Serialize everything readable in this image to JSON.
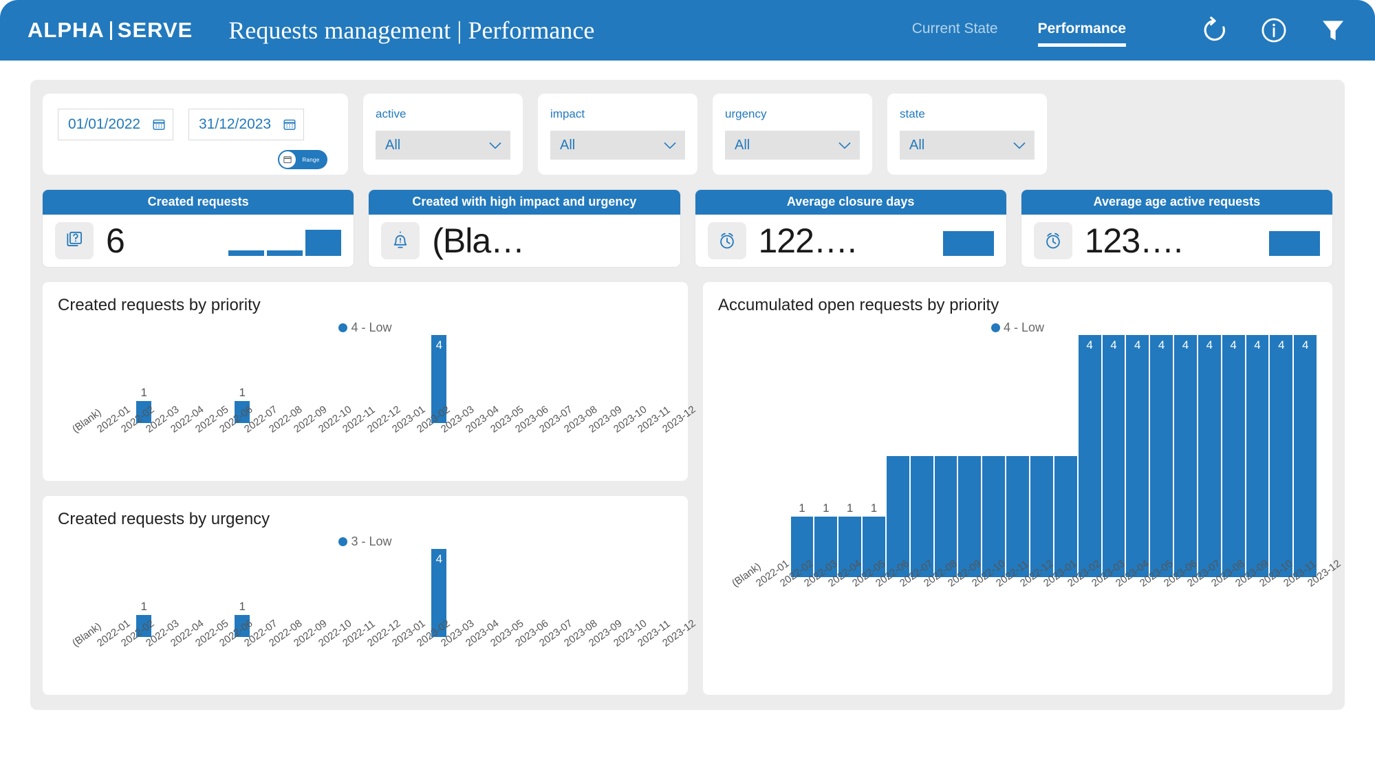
{
  "header": {
    "logo_alpha": "ALPHA",
    "logo_serve": "SERVE",
    "title": "Requests management | Performance",
    "nav": [
      {
        "label": "Current State",
        "active": false
      },
      {
        "label": "Performance",
        "active": true
      }
    ],
    "icons": [
      {
        "name": "refresh-icon"
      },
      {
        "name": "info-icon"
      },
      {
        "name": "filter-icon"
      }
    ]
  },
  "filters": {
    "date_from": "01/01/2022",
    "date_to": "31/12/2023",
    "range_toggle_label": "Range",
    "selects": [
      {
        "label": "active",
        "value": "All"
      },
      {
        "label": "impact",
        "value": "All"
      },
      {
        "label": "urgency",
        "value": "All"
      },
      {
        "label": "state",
        "value": "All"
      }
    ]
  },
  "kpis": [
    {
      "title": "Created requests",
      "value": "6",
      "icon": "request-question-icon",
      "spark": [
        14,
        14,
        100
      ]
    },
    {
      "title": "Created with high impact and urgency",
      "value": "(Bla…",
      "icon": "alert-bell-icon",
      "spark": []
    },
    {
      "title": "Average closure days",
      "value": "122….",
      "icon": "alarm-clock-icon",
      "spark": [
        100
      ]
    },
    {
      "title": "Average age active requests",
      "value": "123….",
      "icon": "alarm-clock-icon",
      "spark": [
        100
      ]
    }
  ],
  "accent_color": "#2279bd",
  "chart_data": [
    {
      "id": "created-by-priority",
      "type": "bar",
      "title": "Created requests by priority",
      "legend": [
        "4 - Low"
      ],
      "legend_position": "top-center",
      "xlabel": "",
      "ylabel": "",
      "ylim": [
        0,
        4
      ],
      "grid": false,
      "categories": [
        "(Blank)",
        "2022-01",
        "2022-02",
        "2022-03",
        "2022-04",
        "2022-05",
        "2022-06",
        "2022-07",
        "2022-08",
        "2022-09",
        "2022-10",
        "2022-11",
        "2022-12",
        "2023-01",
        "2023-02",
        "2023-03",
        "2023-04",
        "2023-05",
        "2023-06",
        "2023-07",
        "2023-08",
        "2023-09",
        "2023-10",
        "2023-11",
        "2023-12"
      ],
      "values": [
        0,
        0,
        0,
        1,
        0,
        0,
        0,
        1,
        0,
        0,
        0,
        0,
        0,
        0,
        0,
        4,
        0,
        0,
        0,
        0,
        0,
        0,
        0,
        0,
        0
      ]
    },
    {
      "id": "created-by-urgency",
      "type": "bar",
      "title": "Created requests by urgency",
      "legend": [
        "3 - Low"
      ],
      "legend_position": "top-center",
      "xlabel": "",
      "ylabel": "",
      "ylim": [
        0,
        4
      ],
      "grid": false,
      "categories": [
        "(Blank)",
        "2022-01",
        "2022-02",
        "2022-03",
        "2022-04",
        "2022-05",
        "2022-06",
        "2022-07",
        "2022-08",
        "2022-09",
        "2022-10",
        "2022-11",
        "2022-12",
        "2023-01",
        "2023-02",
        "2023-03",
        "2023-04",
        "2023-05",
        "2023-06",
        "2023-07",
        "2023-08",
        "2023-09",
        "2023-10",
        "2023-11",
        "2023-12"
      ],
      "values": [
        0,
        0,
        0,
        1,
        0,
        0,
        0,
        1,
        0,
        0,
        0,
        0,
        0,
        0,
        0,
        4,
        0,
        0,
        0,
        0,
        0,
        0,
        0,
        0,
        0
      ]
    },
    {
      "id": "accumulated-open-by-priority",
      "type": "bar",
      "title": "Accumulated open requests by priority",
      "legend": [
        "4 - Low"
      ],
      "legend_position": "top-center",
      "xlabel": "",
      "ylabel": "",
      "ylim": [
        0,
        4
      ],
      "grid": false,
      "categories": [
        "(Blank)",
        "2022-01",
        "2022-02",
        "2022-03",
        "2022-04",
        "2022-05",
        "2022-06",
        "2022-07",
        "2022-08",
        "2022-09",
        "2022-10",
        "2022-11",
        "2022-12",
        "2023-01",
        "2023-02",
        "2023-03",
        "2023-04",
        "2023-05",
        "2023-06",
        "2023-07",
        "2023-08",
        "2023-09",
        "2023-10",
        "2023-11",
        "2023-12"
      ],
      "values": [
        0,
        0,
        0,
        1,
        1,
        1,
        1,
        2,
        2,
        2,
        2,
        2,
        2,
        2,
        2,
        4,
        4,
        4,
        4,
        4,
        4,
        4,
        4,
        4,
        4
      ]
    }
  ]
}
